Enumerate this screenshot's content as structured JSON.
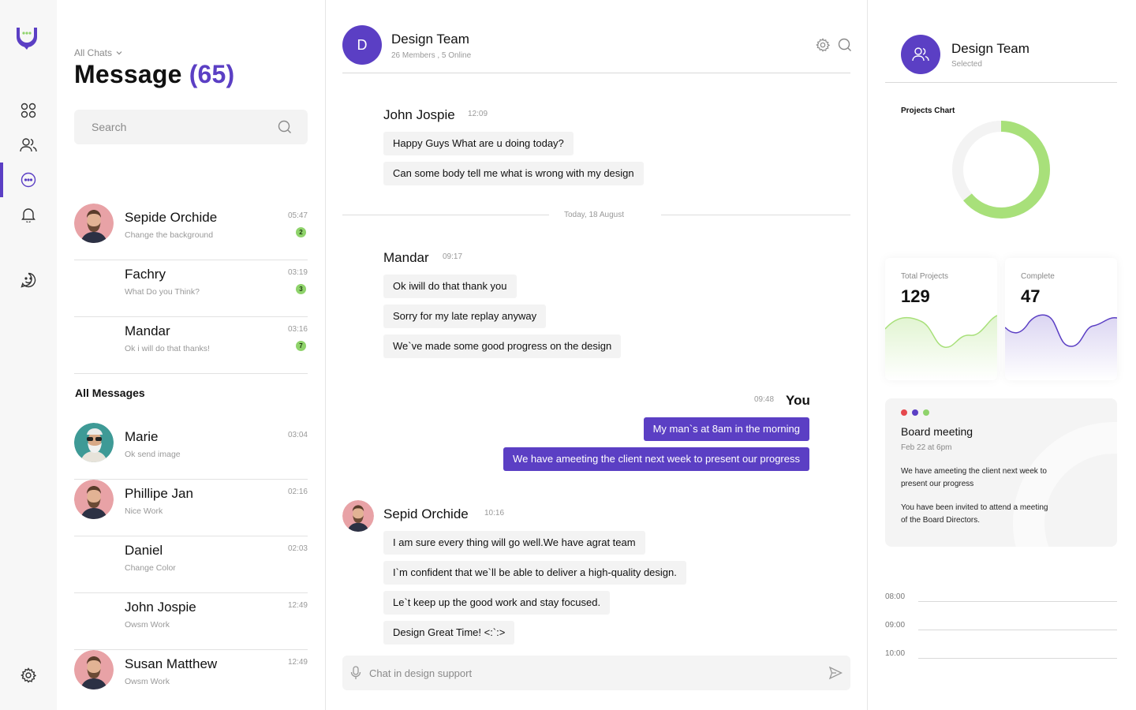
{
  "app": {
    "nav_icons": [
      "grid-icon",
      "users-icon",
      "chat-icon",
      "bell-icon",
      "emoji-chat-icon",
      "gear-icon"
    ],
    "accent_color": "#5b3fc4",
    "online_badge_color": "#8fd36b"
  },
  "list": {
    "filter_label": "All Chats",
    "title": "Message",
    "count": "(65)",
    "search_placeholder": "Search",
    "pinned": [
      {
        "name": "Sepide Orchide",
        "preview": "Change the background",
        "time": "05:47",
        "badge": "2"
      },
      {
        "name": "Fachry",
        "preview": "What Do you Think?",
        "time": "03:19",
        "badge": "3"
      },
      {
        "name": "Mandar",
        "preview": "Ok i will do that thanks!",
        "time": "03:16",
        "badge": "7"
      }
    ],
    "all_label": "All Messages",
    "all": [
      {
        "name": "Marie",
        "preview": "Ok send image",
        "time": "03:04"
      },
      {
        "name": "Phillipe Jan",
        "preview": "Nice Work",
        "time": "02:16"
      },
      {
        "name": "Daniel",
        "preview": "Change Color",
        "time": "02:03"
      },
      {
        "name": "John Jospie",
        "preview": "Owsm Work",
        "time": "12:49"
      },
      {
        "name": "Susan Matthew",
        "preview": "Owsm Work",
        "time": "12:49"
      }
    ]
  },
  "chat": {
    "avatar_letter": "D",
    "title": "Design Team",
    "subtitle": "26 Members , 5 Online",
    "date_divider": "Today, 18 August",
    "groups": [
      {
        "sender": "John Jospie",
        "time": "12:09",
        "messages": [
          "Happy Guys What are u doing today?",
          "Can some body tell me what is wrong with my design"
        ]
      },
      {
        "sender": "Mandar",
        "time": "09:17",
        "messages": [
          "Ok iwill do that thank you",
          "Sorry for my late replay anyway",
          "We`ve made some good progress on the design"
        ]
      },
      {
        "sender": "You",
        "time": "09:48",
        "messages": [
          "My man`s at 8am in the morning",
          "We have ameeting the client next week to present our progress"
        ]
      },
      {
        "sender": "Sepid Orchide",
        "time": "10:16",
        "messages": [
          "I am sure every thing will go well.We have agrat team",
          "I`m confident that we`ll be able to deliver a high-quality design.",
          "Le`t keep up the good work and stay focused.",
          "Design Great Time! <:`:>"
        ]
      }
    ],
    "composer_placeholder": "Chat in design support"
  },
  "side": {
    "title": "Design Team",
    "subtitle": "Selected",
    "chart_label": "Projects Chart",
    "donut": {
      "progress_fraction": 0.64,
      "color": "#a8e07a",
      "track_color": "#f3f3f3"
    },
    "stats": [
      {
        "label": "Total Projects",
        "value": "129",
        "color": "#a8e07a"
      },
      {
        "label": "Complete",
        "value": "47",
        "color": "#5b3fc4"
      }
    ],
    "meeting": {
      "dot_colors": [
        "#e5484d",
        "#5b3fc4",
        "#8fd36b"
      ],
      "title": "Board meeting",
      "date": "Feb 22 at 6pm",
      "text1": "We have ameeting the client next week to present our progress",
      "text2": "You have been invited to attend a meeting of the Board Directors."
    },
    "schedule": [
      "08:00",
      "09:00",
      "10:00"
    ]
  }
}
